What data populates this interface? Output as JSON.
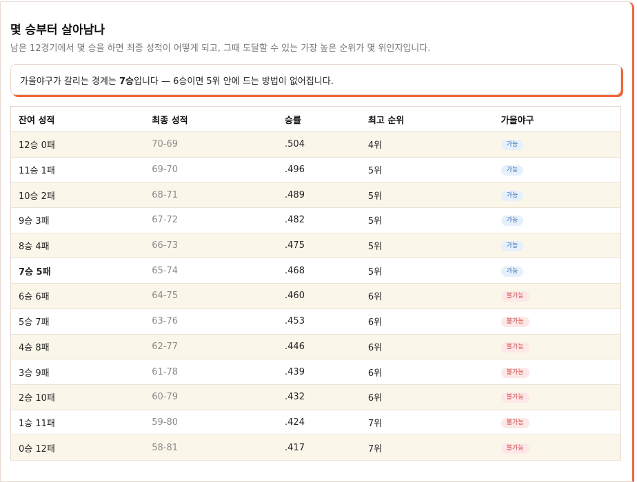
{
  "header": {
    "title": "몇 승부터 살아남나",
    "subtitle": "남은 12경기에서 몇 승을 하면 최종 성적이 어떻게 되고, 그때 도달할 수 있는 가장 높은 순위가 몇 위인지입니다."
  },
  "callout": {
    "prefix": "가을야구가 갈리는 경계는 ",
    "emphasis": "7승",
    "suffix": "입니다 — 6승이면 5위 안에 드는 방법이 없어집니다."
  },
  "table": {
    "columns": [
      "잔여 성적",
      "최종 성적",
      "승률",
      "최고 순위",
      "가을야구"
    ],
    "rows": [
      {
        "record": "12승 0패",
        "final": "70-69",
        "pct": ".504",
        "rank": "4위",
        "status": "가능"
      },
      {
        "record": "11승 1패",
        "final": "69-70",
        "pct": ".496",
        "rank": "5위",
        "status": "가능"
      },
      {
        "record": "10승 2패",
        "final": "68-71",
        "pct": ".489",
        "rank": "5위",
        "status": "가능"
      },
      {
        "record": "9승 3패",
        "final": "67-72",
        "pct": ".482",
        "rank": "5위",
        "status": "가능"
      },
      {
        "record": "8승 4패",
        "final": "66-73",
        "pct": ".475",
        "rank": "5위",
        "status": "가능"
      },
      {
        "record": "7승 5패",
        "final": "65-74",
        "pct": ".468",
        "rank": "5위",
        "status": "가능"
      },
      {
        "record": "6승 6패",
        "final": "64-75",
        "pct": ".460",
        "rank": "6위",
        "status": "불가능"
      },
      {
        "record": "5승 7패",
        "final": "63-76",
        "pct": ".453",
        "rank": "6위",
        "status": "불가능"
      },
      {
        "record": "4승 8패",
        "final": "62-77",
        "pct": ".446",
        "rank": "6위",
        "status": "불가능"
      },
      {
        "record": "3승 9패",
        "final": "61-78",
        "pct": ".439",
        "rank": "6위",
        "status": "불가능"
      },
      {
        "record": "2승 10패",
        "final": "60-79",
        "pct": ".432",
        "rank": "6위",
        "status": "불가능"
      },
      {
        "record": "1승 11패",
        "final": "59-80",
        "pct": ".424",
        "rank": "7위",
        "status": "불가능"
      },
      {
        "record": "0승 12패",
        "final": "58-81",
        "pct": ".417",
        "rank": "7위",
        "status": "불가능"
      }
    ]
  },
  "colors": {
    "accent": "#f0643a",
    "row_alt": "#fbf6ea",
    "badge_yes_bg": "#e6f0fb",
    "badge_yes_text": "#3a6fb0",
    "badge_no_bg": "#fde7e7",
    "badge_no_text": "#d04a4a"
  }
}
